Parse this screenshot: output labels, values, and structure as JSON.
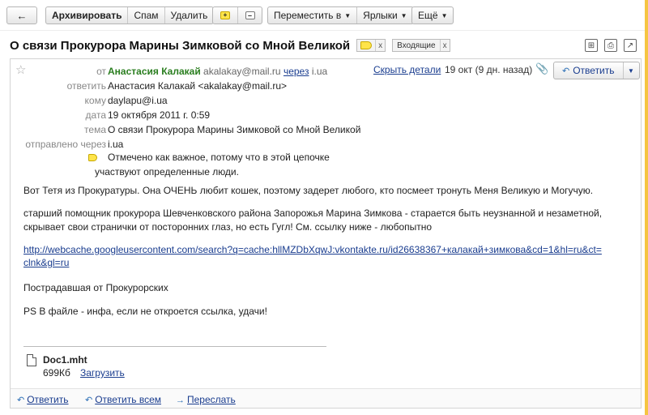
{
  "toolbar": {
    "back_icon": "back-arrow-icon",
    "archive": "Архивировать",
    "spam": "Спам",
    "delete": "Удалить",
    "mark_important_icon": "plus-flag-icon",
    "unmark_icon": "minus-icon",
    "move_to": "Переместить в",
    "labels": "Ярлыки",
    "more": "Ещё"
  },
  "subject": {
    "title": "О связи Прокурора Марины Зимковой со Мной Великой",
    "label_inbox": "Входящие",
    "remove_x": "x",
    "accent": "#ffe44a"
  },
  "message": {
    "header": {
      "from_label": "от",
      "from_name": "Анастасия Калакай",
      "from_email": "akalakay@mail.ru",
      "via_word": "через",
      "via_domain": "i.ua",
      "reply_to_label": "ответить",
      "reply_to_value": "Анастасия Калакай <akalakay@mail.ru>",
      "to_label": "кому",
      "to_value": "daylapu@i.ua",
      "date_label": "дата",
      "date_value": "19 октября 2011 г. 0:59",
      "subject_label": "тема",
      "subject_value": "О связи Прокурора Марины Зимковой со Мной Великой",
      "sent_via_label": "отправлено через",
      "sent_via_value": "i.ua",
      "important_line1": "Отмечено как важное, потому что в этой цепочке",
      "important_line2": "участвуют определенные люди.",
      "hide_details": "Скрыть детали",
      "short_date": "19 окт (9 дн. назад)",
      "reply_button": "Ответить"
    },
    "body": {
      "p1": "Вот Тетя из Прокуратуры. Она ОЧЕНЬ любит кошек, поэтому задерет любого, кто посмеет тронуть Меня Великую и Могучую.",
      "p2_line1": "старший помощник прокурора Шевченковского района Запорожья Марина Зимкова - старается быть неузнанной и незаметной,",
      "p2_line2": "скрывает свои странички от посторонних глаз, но есть Гугл! См. ссылку ниже - любопытно",
      "link_line1": "http://webcache.googleusercontent.com/search?q=cache:hllMZDbXqwJ:vkontakte.ru/id26638367+калакай+зимкова&cd=1&hl=ru&ct=",
      "link_line2": "clnk&gl=ru",
      "p3": "Пострадавшая от Прокурорских",
      "p4": "PS В файле - инфа, если не откроется ссылка, удачи!"
    },
    "attachment": {
      "name": "Doc1.mht",
      "size": "699Кб",
      "download": "Загрузить"
    },
    "footer": {
      "reply": "Ответить",
      "reply_all": "Ответить всем",
      "forward": "Переслать"
    }
  }
}
